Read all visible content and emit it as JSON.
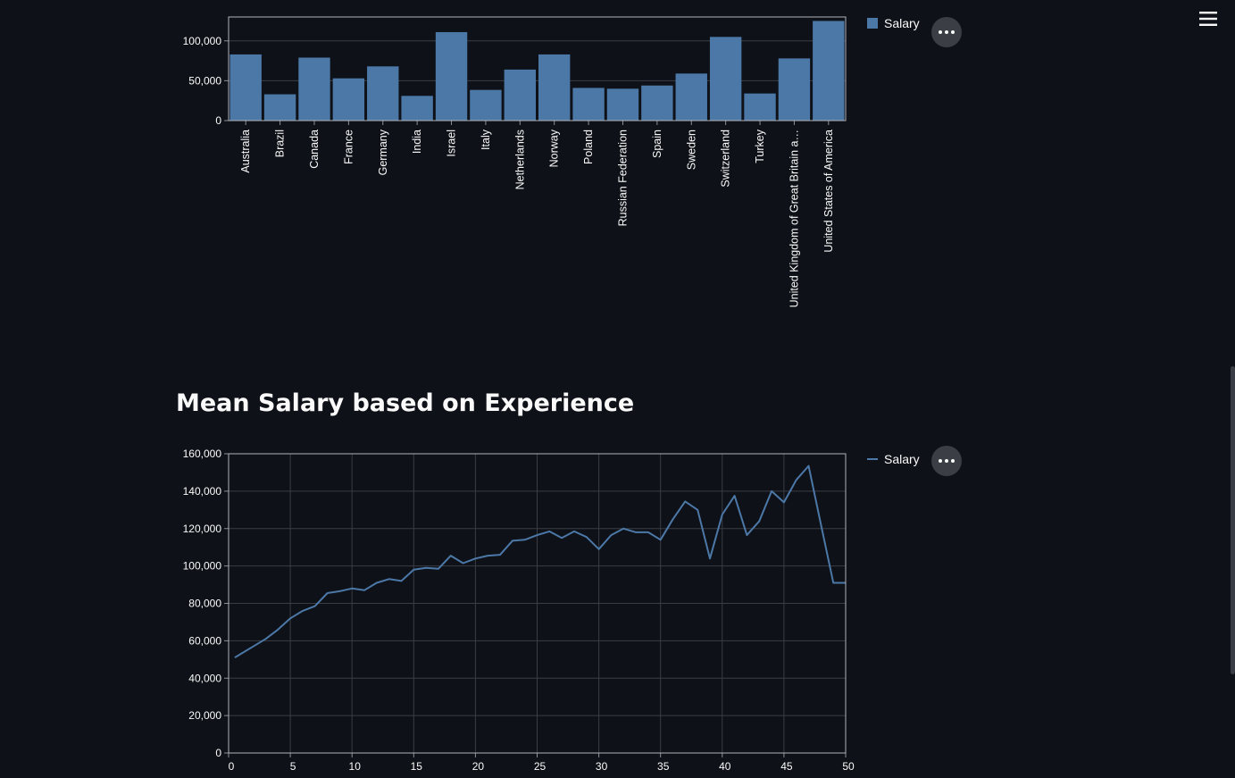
{
  "colors": {
    "background": "#0e1117",
    "series": "#4c78a8",
    "grid": "#3a3d45",
    "axis": "#8c8f96",
    "text": "#fafafa"
  },
  "header": {
    "menu_icon": "hamburger-menu-icon"
  },
  "charts": {
    "bar": {
      "legend_label": "Salary",
      "more_icon": "more-horizontal-icon"
    },
    "line": {
      "heading": "Mean Salary based on Experience",
      "legend_label": "Salary",
      "more_icon": "more-horizontal-icon"
    }
  },
  "chart_data": [
    {
      "type": "bar",
      "categories": [
        "Australia",
        "Brazil",
        "Canada",
        "France",
        "Germany",
        "India",
        "Israel",
        "Italy",
        "Netherlands",
        "Norway",
        "Poland",
        "Russian Federation",
        "Spain",
        "Sweden",
        "Switzerland",
        "Turkey",
        "United Kingdom of Great Britain a…",
        "United States of America"
      ],
      "series": [
        {
          "name": "Salary",
          "values": [
            83000,
            33000,
            79000,
            53000,
            68000,
            31000,
            111000,
            38500,
            64000,
            83000,
            41000,
            40000,
            44000,
            59000,
            105000,
            34000,
            78000,
            125000
          ]
        }
      ],
      "ylim": [
        0,
        130000
      ],
      "yticks": [
        0,
        50000,
        100000
      ],
      "ytick_labels": [
        "0",
        "50,000",
        "100,000"
      ],
      "grid": true,
      "legend": "top-right"
    },
    {
      "type": "line",
      "x": [
        0.5,
        1,
        2,
        3,
        4,
        5,
        6,
        7,
        8,
        9,
        10,
        11,
        12,
        13,
        14,
        15,
        16,
        17,
        18,
        19,
        20,
        21,
        22,
        23,
        24,
        25,
        26,
        27,
        28,
        29,
        30,
        31,
        32,
        33,
        34,
        35,
        36,
        37,
        38,
        39,
        40,
        41,
        42,
        43,
        44,
        45,
        46,
        47,
        48,
        49,
        50
      ],
      "series": [
        {
          "name": "Salary",
          "values": [
            51000,
            53000,
            57000,
            61000,
            66000,
            72000,
            76000,
            78500,
            85500,
            86500,
            88000,
            87000,
            91000,
            93000,
            92000,
            98000,
            99000,
            98500,
            105500,
            101500,
            104000,
            105500,
            106000,
            113500,
            114000,
            116500,
            118500,
            115000,
            118500,
            115500,
            109000,
            116500,
            120000,
            118000,
            118000,
            114000,
            125000,
            134500,
            130000,
            104000,
            127500,
            137500,
            116500,
            124000,
            140000,
            134000,
            146000,
            153500,
            122000,
            91000,
            91000
          ]
        }
      ],
      "xlim": [
        0,
        50
      ],
      "xticks": [
        0,
        5,
        10,
        15,
        20,
        25,
        30,
        35,
        40,
        45,
        50
      ],
      "ylim": [
        0,
        160000
      ],
      "yticks": [
        0,
        20000,
        40000,
        60000,
        80000,
        100000,
        120000,
        140000,
        160000
      ],
      "ytick_labels": [
        "0",
        "20,000",
        "40,000",
        "60,000",
        "80,000",
        "100,000",
        "120,000",
        "140,000",
        "160,000"
      ],
      "grid": true,
      "legend": "top-right"
    }
  ]
}
